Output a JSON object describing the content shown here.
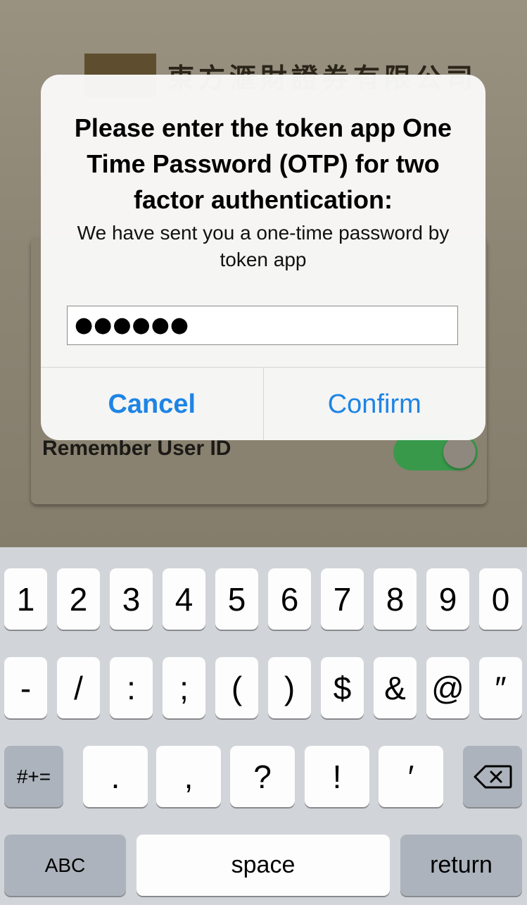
{
  "background": {
    "company_name": "東方滙財證券有限公司",
    "remember_label": "Remember User ID",
    "remember_enabled": true
  },
  "alert": {
    "title": "Please enter the token app One Time Password (OTP) for two factor authentication:",
    "message": "We have sent you a one-time password by token app",
    "input_value": "●●●●●●",
    "cancel_label": "Cancel",
    "confirm_label": "Confirm"
  },
  "keyboard": {
    "row1": [
      "1",
      "2",
      "3",
      "4",
      "5",
      "6",
      "7",
      "8",
      "9",
      "0"
    ],
    "row2": [
      "-",
      "/",
      ":",
      ";",
      "(",
      ")",
      "$",
      "&",
      "@",
      "″"
    ],
    "row3": [
      ".",
      ",",
      "?",
      "!",
      "′"
    ],
    "symbols_label": "#+=",
    "abc_label": "ABC",
    "space_label": "space",
    "return_label": "return",
    "backspace_icon": "backspace-icon"
  },
  "colors": {
    "accent": "#1d84e5",
    "toggle_on": "#38994a",
    "keyboard_bg": "#d1d4d9"
  }
}
